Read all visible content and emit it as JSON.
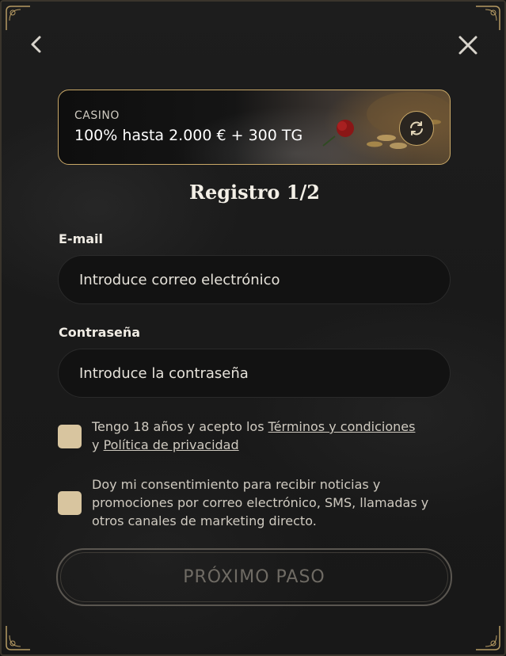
{
  "header": {
    "back_icon": "chevron-left-icon",
    "close_icon": "close-icon"
  },
  "bonus": {
    "category": "CASINO",
    "title": "100% hasta 2.000 € + 300 TG",
    "refresh_icon": "refresh-icon"
  },
  "form": {
    "title": "Registro 1/2",
    "email": {
      "label": "E-mail",
      "placeholder": "Introduce correo electrónico"
    },
    "password": {
      "label": "Contraseña",
      "placeholder": "Introduce la contraseña"
    },
    "terms": {
      "prefix": "Tengo 18 años y acepto los ",
      "terms_link": "Términos y condiciones",
      "middle": "y ",
      "privacy_link": "Política de privacidad"
    },
    "consent": {
      "text": "Doy mi consentimiento para recibir noticias y promociones por correo electrónico, SMS, llamadas y otros canales de marketing directo."
    },
    "next_button": "PRÓXIMO PASO"
  },
  "colors": {
    "accent_gold": "#c9a867",
    "checkbox": "#d8c59f",
    "background": "#1a1a1a"
  }
}
